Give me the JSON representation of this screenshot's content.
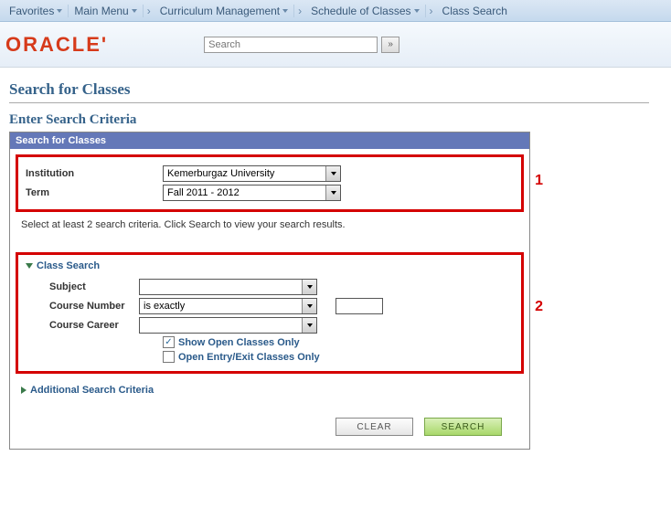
{
  "topbar": {
    "favorites": "Favorites",
    "mainmenu": "Main Menu",
    "crumbs": [
      "Curriculum Management",
      "Schedule of Classes",
      "Class Search"
    ]
  },
  "header": {
    "logo": "ORACLE",
    "search_placeholder": "Search",
    "go": "»"
  },
  "titles": {
    "page": "Search for Classes",
    "sub": "Enter Search Criteria",
    "panel": "Search for Classes"
  },
  "box1": {
    "institution_label": "Institution",
    "institution_value": "Kemerburgaz University",
    "term_label": "Term",
    "term_value": "Fall 2011 - 2012",
    "annot": "1"
  },
  "hint": "Select at least 2 search criteria. Click Search to view your search results.",
  "box2": {
    "header": "Class Search",
    "subject_label": "Subject",
    "subject_value": "",
    "coursenum_label": "Course Number",
    "coursenum_op": "is exactly",
    "career_label": "Course Career",
    "career_value": "",
    "chk_open": "Show Open Classes Only",
    "chk_entry": "Open Entry/Exit Classes Only",
    "annot": "2"
  },
  "additional": "Additional Search Criteria",
  "buttons": {
    "clear": "Clear",
    "search": "Search"
  }
}
